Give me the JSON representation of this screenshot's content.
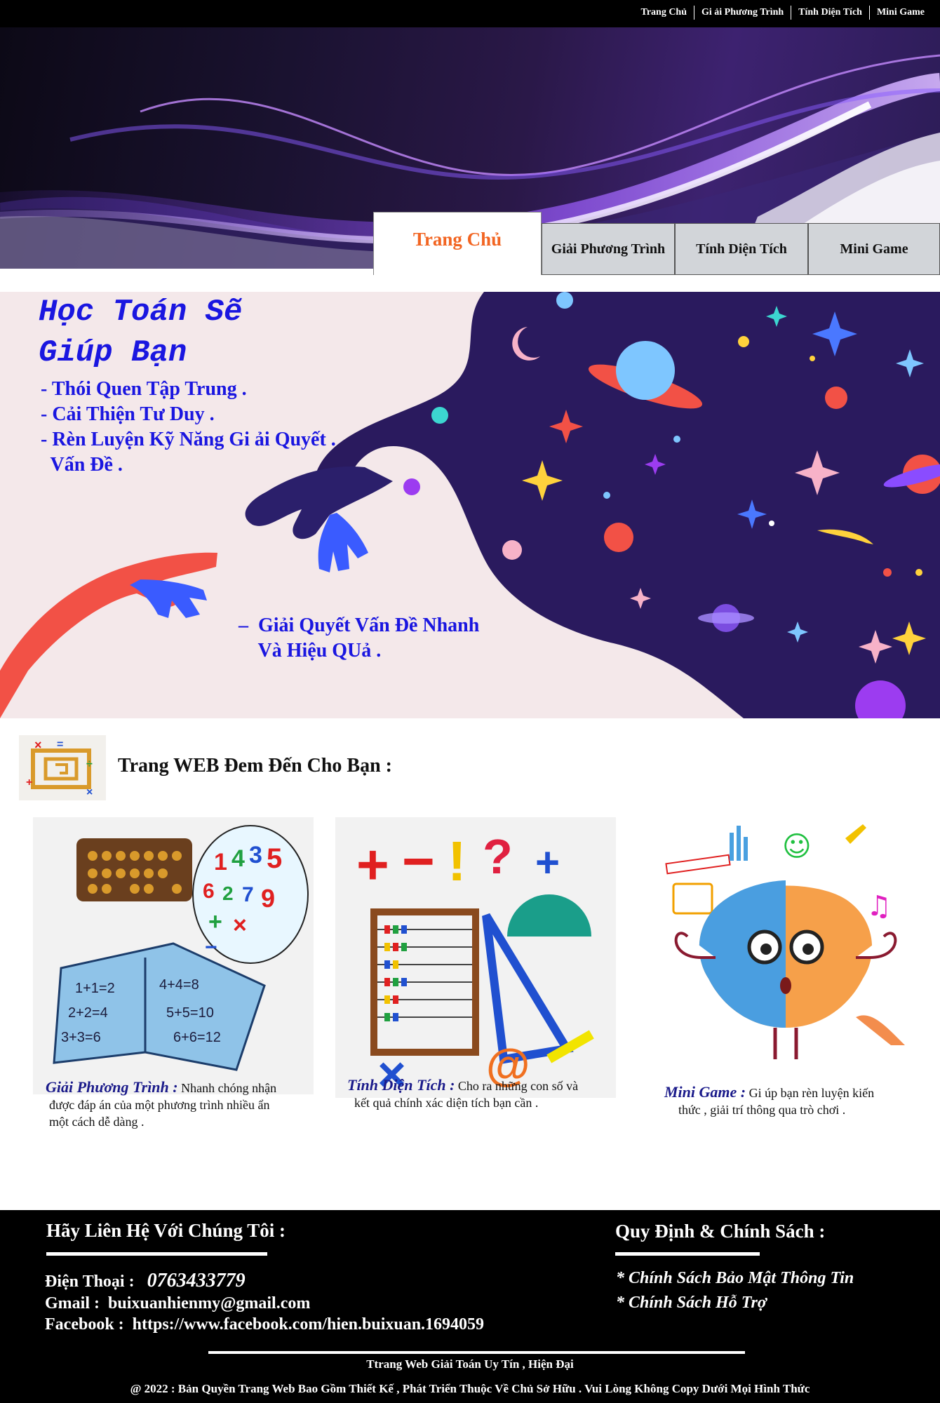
{
  "topnav": {
    "items": [
      "Trang Chủ",
      "Gi ải Phương Trình",
      "Tính Diện Tích",
      "Mini Game"
    ]
  },
  "tabs": {
    "active": "Trang Chủ",
    "items": [
      "Giải Phương Trình",
      "Tính Diện Tích",
      "Mini Game"
    ]
  },
  "hero": {
    "title_line1": "Học Toán Sẽ",
    "title_line2": "Giúp Bạn",
    "bullets": [
      "- Thói Quen Tập Trung .",
      "- Cải Thiện Tư Duy .",
      "- Rèn Luyện Kỹ Năng Gi ải Quyết .",
      "  Vấn Đề ."
    ],
    "extra_line1": "–  Giải Quyết Vấn Đề Nhanh",
    "extra_line2": "    Và Hiệu QUả ."
  },
  "features": {
    "heading": "Trang WEB Đem Đến Cho Bạn :",
    "cards": [
      {
        "label": "Giải Phương Trình :",
        "desc": " Nhanh chóng nhận",
        "desc2": "được đáp án của một phương trình nhiều ẩn",
        "desc3": "một cách dễ dàng ."
      },
      {
        "label": "Tính Diện Tích :",
        "desc": " Cho ra những con số và",
        "desc2": "kết quả chính xác diện tích bạn cần ."
      },
      {
        "label": "Mini Game :",
        "desc": " Gi úp bạn rèn luyện kiến",
        "desc2": "thức , giải trí thông qua trò chơi ."
      }
    ],
    "book_numbers": [
      "1+1=2",
      "2+2=4",
      "3+3=6",
      "4+4=8",
      "5+5=10",
      "6+6=12"
    ],
    "bubble_numbers": [
      "1",
      "4",
      "3",
      "5",
      "6",
      "2",
      "7",
      "9"
    ]
  },
  "footer": {
    "contact_heading": "Hãy Liên Hệ Với Chúng Tôi :",
    "phone_label": "Điện Thoại :",
    "phone": "0763433779",
    "gmail_label": "Gmail :",
    "gmail": "buixuanhienmy@gmail.com",
    "facebook_label": "Facebook :",
    "facebook": "https://www.facebook.com/hien.buixuan.1694059",
    "policy_heading": "Quy Định & Chính Sách :",
    "policies": [
      "* Chính Sách Bảo Mật Thông Tin",
      "* Chính Sách Hỗ Trợ"
    ],
    "tagline": "Ttrang Web Giải Toán Uy Tín , Hiện Đại",
    "copyright": "@ 2022 : Bản Quyền Trang Web Bao Gồm Thiết Kế , Phát Triển Thuộc Về Chủ Sở Hữu . Vui Lòng Không Copy Dưới Mọi Hình Thức"
  },
  "colors": {
    "accent_orange": "#f26522",
    "hero_blue": "#1a16e0",
    "space_purple": "#2a1a5e",
    "hand_red": "#f25146",
    "hand_navy": "#2b1f6b"
  }
}
